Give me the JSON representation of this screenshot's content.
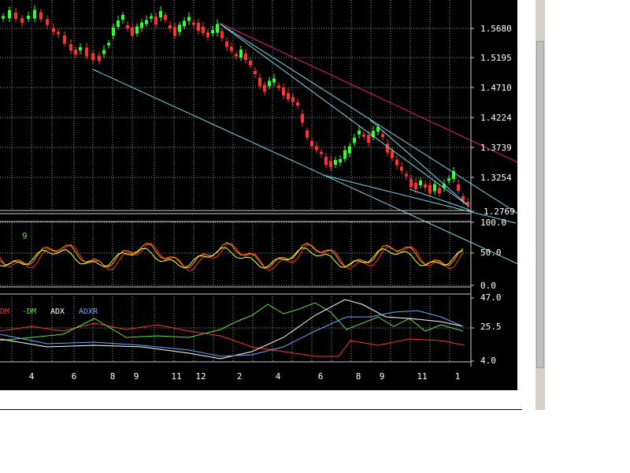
{
  "price_panel": {
    "axis_labels": [
      "1.5680",
      "1.5195",
      "1.4710",
      "1.4224",
      "1.3739",
      "1.3254",
      "1.2769"
    ],
    "axis_values": [
      1.568,
      1.5195,
      1.471,
      1.4224,
      1.3739,
      1.3254,
      1.2769
    ],
    "bull_color": "#33ff33",
    "bear_color": "#ff3333",
    "trendline_color": "#7fd8e8",
    "resistance_color": "#e0207a",
    "grid_color": "#9a9a9a"
  },
  "oscillator_panel": {
    "axis_labels": [
      "100.0",
      "50.0",
      "0.0"
    ],
    "marker_label": "9",
    "lines": [
      "red",
      "orange",
      "yellow"
    ]
  },
  "dmi_panel": {
    "axis_labels": [
      "47.0",
      "25.5",
      "4.0"
    ],
    "legend": [
      {
        "label": "DM",
        "color": "#ff3333"
      },
      {
        "label": "-DM",
        "color": "#66dd44"
      },
      {
        "label": "ADX",
        "color": "#ffffff"
      },
      {
        "label": "ADXR",
        "color": "#6aa8ff"
      }
    ]
  },
  "x_axis": {
    "labels": [
      "4",
      "6",
      "8",
      "9",
      "11",
      "12",
      "2",
      "4",
      "6",
      "8",
      "9",
      "11",
      "1"
    ]
  },
  "chart_data": [
    {
      "type": "candlestick",
      "title": "",
      "ylim": [
        1.2769,
        1.568
      ],
      "y_ticks": [
        1.568,
        1.5195,
        1.471,
        1.4224,
        1.3739,
        1.3254,
        1.2769
      ]
    },
    {
      "type": "line",
      "title": "",
      "ylim": [
        0,
        100
      ],
      "y_ticks": [
        100,
        50,
        0
      ]
    },
    {
      "type": "line",
      "title": "",
      "series": [
        {
          "name": "DM"
        },
        {
          "name": "-DM"
        },
        {
          "name": "ADX"
        },
        {
          "name": "ADXR"
        }
      ],
      "ylim": [
        4.0,
        47.0
      ],
      "y_ticks": [
        47.0,
        25.5,
        4.0
      ]
    }
  ]
}
